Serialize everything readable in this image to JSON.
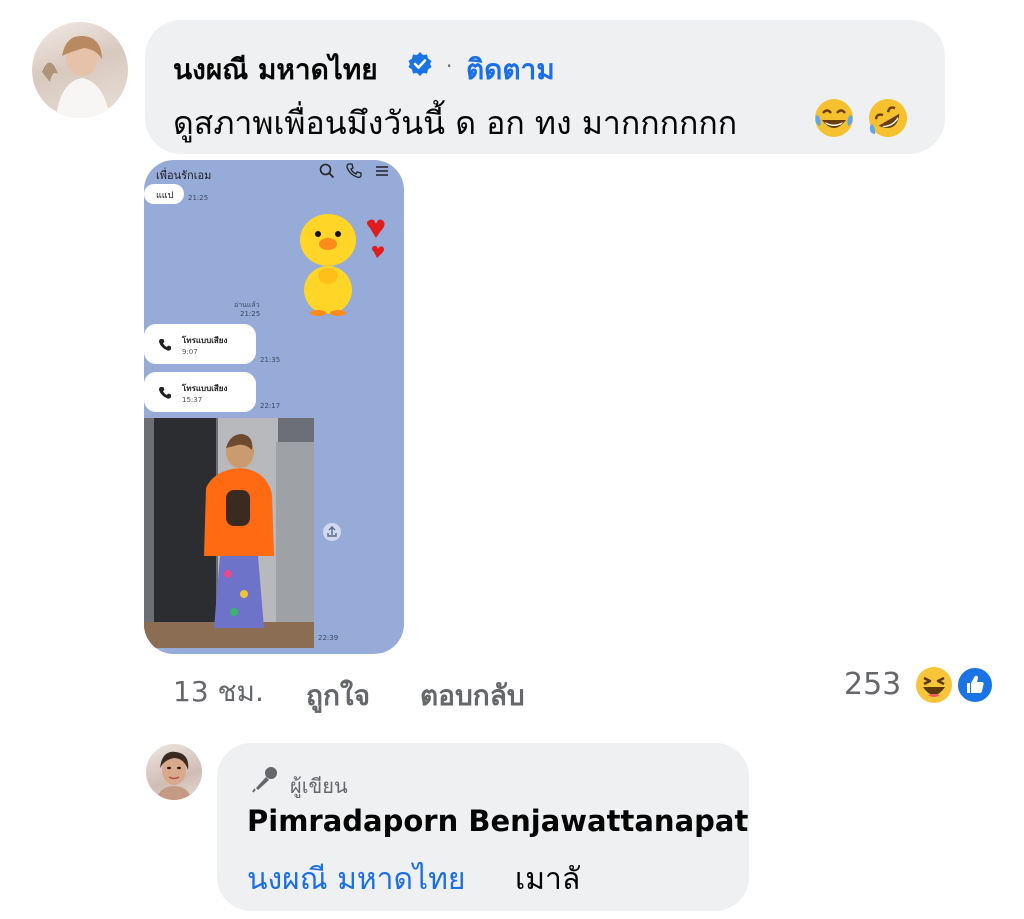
{
  "comment": {
    "author": "นงผณี มหาดไทย",
    "separator": "·",
    "follow_label": "ติดตาม",
    "text": "ดูสภาพเพื่อนมึงวันนี้ ด อก ทง มากกกกกก",
    "emojis": [
      "face-with-tears-of-joy",
      "rolling-on-floor-laughing"
    ],
    "time": "13 ชม.",
    "like_label": "ถูกใจ",
    "reply_label": "ตอบกลับ",
    "reaction_count": "253",
    "reaction_icons": [
      "haha-icon",
      "like-icon"
    ]
  },
  "attachment": {
    "chat_name": "เพื่อนรักเอม",
    "sent_text": "แแป",
    "sent_time": "21:25",
    "read_label": "อ่านแล้ว",
    "read_time": "21:25",
    "calls": [
      {
        "title": "โทรแบบเสียง",
        "duration": "9:07",
        "time": "21:35"
      },
      {
        "title": "โทรแบบเสียง",
        "duration": "15:37",
        "time": "22:17"
      }
    ],
    "photo_time": "22:39"
  },
  "reply": {
    "badge_label": "ผู้เขียน",
    "author": "Pimradaporn Benjawattanapat",
    "mention": "นงผณี มหาดไทย",
    "text": "เมาลั"
  },
  "colors": {
    "link": "#1a6ee8",
    "bubble": "#eff0f2",
    "muted": "#65676b",
    "chat_bg": "#97abd8"
  }
}
